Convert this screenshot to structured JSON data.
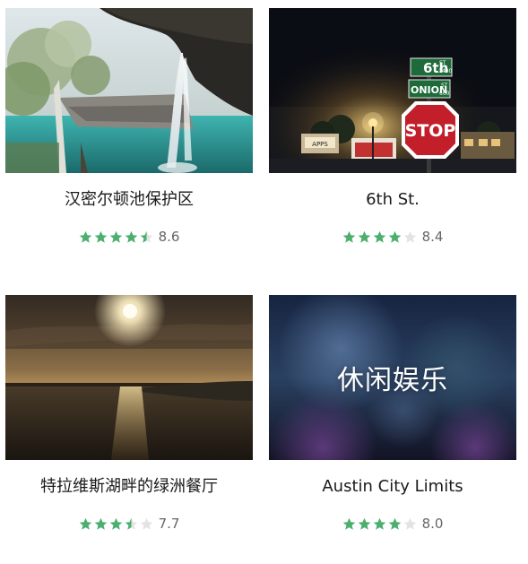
{
  "colors": {
    "star_filled": "#4caf6e",
    "star_empty": "#e3e3e3",
    "score_text": "#666666"
  },
  "cards": [
    {
      "title": "汉密尔顿池保护区",
      "rating": 4.5,
      "score": "8.6",
      "image_subject": "waterfall-grotto"
    },
    {
      "title": "6th St.",
      "rating": 4,
      "score": "8.4",
      "image_subject": "night-street-signs",
      "image_texts": {
        "sign_6th": "6th",
        "sign_st": "ST",
        "sign_1400": "1400",
        "sign_onion": "ONION",
        "sign_st2": "ST",
        "sign_600": "600",
        "sign_stop": "STOP"
      }
    },
    {
      "title": "特拉维斯湖畔的绿洲餐厅",
      "rating": 3.5,
      "score": "7.7",
      "image_subject": "lake-sunset"
    },
    {
      "title": "Austin City Limits",
      "rating": 4,
      "score": "8.0",
      "image_subject": "concert-blur",
      "overlay": "休闲娱乐"
    }
  ]
}
